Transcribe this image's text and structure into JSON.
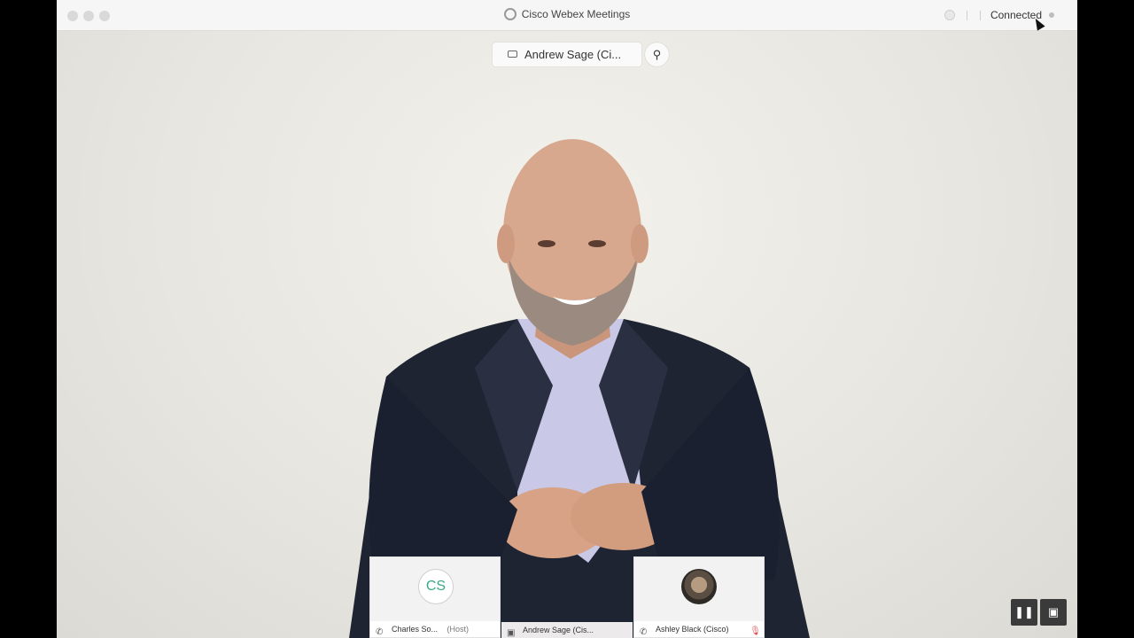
{
  "window": {
    "title": "Cisco Webex Meetings",
    "status": "Connected"
  },
  "stage": {
    "active_speaker_label": "Andrew Sage (Ci...",
    "pin_icon": "pin-icon"
  },
  "participants": [
    {
      "name": "Charles So...",
      "role": "(Host)",
      "initials": "CS",
      "icon": "phone-icon",
      "muted": false
    },
    {
      "name": "Andrew Sage (Cis...",
      "role": "",
      "initials": "",
      "icon": "video-icon",
      "muted": false
    },
    {
      "name": "Ashley Black (Cisco)",
      "role": "",
      "initials": "",
      "icon": "phone-icon",
      "muted": true
    }
  ],
  "controls": {
    "pause_icon": "pause-icon",
    "layout_icon": "layout-icon"
  },
  "colors": {
    "initials": "#3aa88a",
    "mute": "#e05050",
    "background": "#eceae5"
  }
}
